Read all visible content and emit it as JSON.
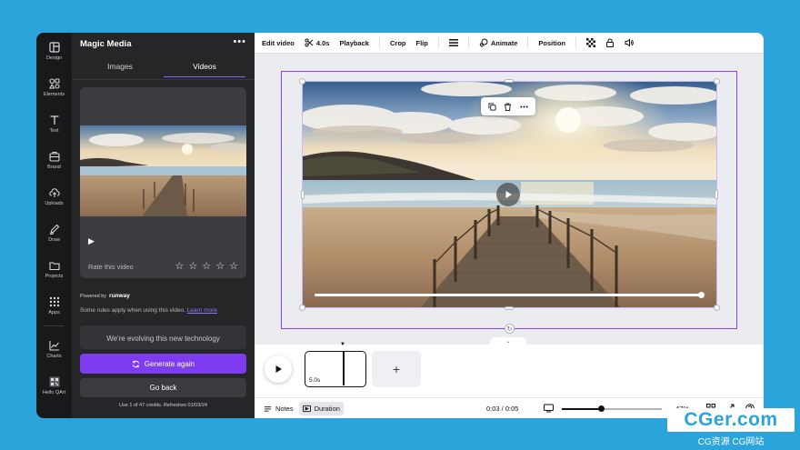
{
  "rail": {
    "items": [
      {
        "label": "Design",
        "icon": "layout-icon"
      },
      {
        "label": "Elements",
        "icon": "shapes-icon"
      },
      {
        "label": "Text",
        "icon": "text-icon"
      },
      {
        "label": "Brand",
        "icon": "brand-icon"
      },
      {
        "label": "Uploads",
        "icon": "cloud-upload-icon"
      },
      {
        "label": "Draw",
        "icon": "pen-icon"
      },
      {
        "label": "Projects",
        "icon": "folder-icon"
      },
      {
        "label": "Apps",
        "icon": "grid-icon"
      },
      {
        "label": "Charts",
        "icon": "chart-icon"
      },
      {
        "label": "Hello QArt",
        "icon": "qr-icon"
      }
    ]
  },
  "panel": {
    "title": "Magic Media",
    "more": "•••",
    "tabs": [
      "Images",
      "Videos"
    ],
    "active_tab": "Videos",
    "card": {
      "rate_label": "Rate this video",
      "stars": [
        "☆",
        "☆",
        "☆",
        "☆",
        "☆"
      ]
    },
    "powered_by": "Powered by",
    "provider": "runway",
    "rules_text": "Some rules apply when using this video.",
    "learn_more": "Learn more",
    "evolving": "We're evolving this new technology",
    "generate_again": "Generate again",
    "go_back": "Go back",
    "credits": "Use 1 of 47 credits. Refreshes 01/03/24"
  },
  "toolbar": {
    "edit_video": "Edit video",
    "duration": "4.0s",
    "playback": "Playback",
    "crop": "Crop",
    "flip": "Flip",
    "animate": "Animate",
    "position": "Position"
  },
  "timeline": {
    "clip_duration": "5.0s",
    "add_label": "+"
  },
  "footer": {
    "notes": "Notes",
    "duration": "Duration",
    "time": "0:03 / 0:05",
    "zoom": "47%",
    "zoom_level": 0.47
  },
  "watermark": {
    "title": "CGer.com",
    "subtitle": "CG资源 CG网站"
  },
  "colors": {
    "accent": "#8b3dff",
    "generate_button": "#7d3cf0",
    "background": "#2ba4dc"
  }
}
